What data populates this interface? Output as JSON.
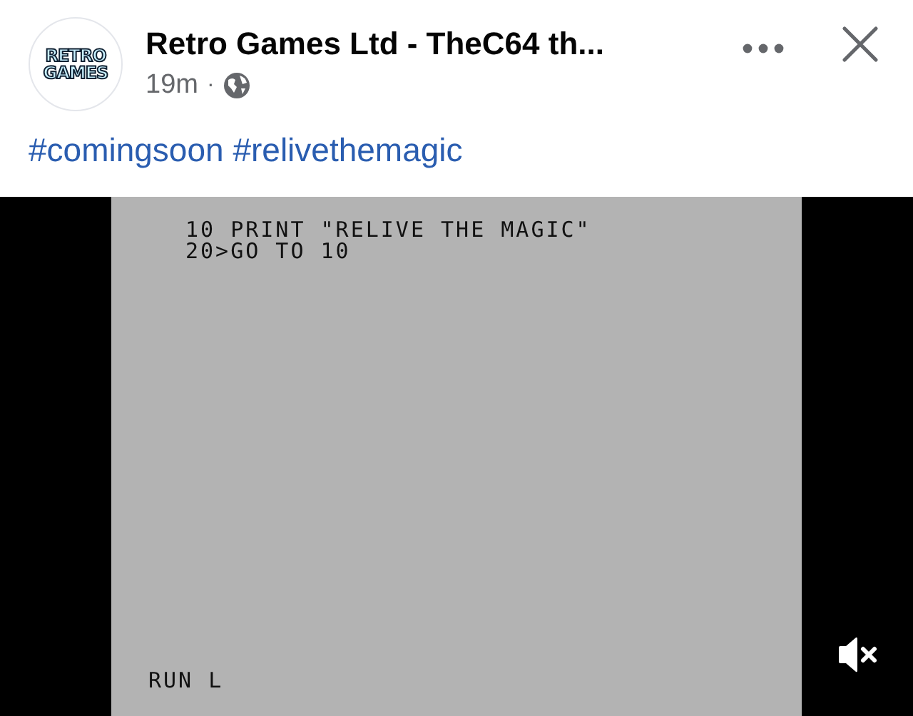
{
  "post": {
    "avatar_text": [
      "RETRO",
      "GAMES"
    ],
    "author": "Retro Games Ltd - TheC64 th...",
    "time": "19m",
    "separator": "·",
    "text": "#comingsoon #relivethemagic"
  },
  "video": {
    "screen_lines": [
      "10 PRINT \"RELIVE THE MAGIC\"",
      "20>GO TO 10"
    ],
    "status_line": "RUN L",
    "muted": true
  }
}
